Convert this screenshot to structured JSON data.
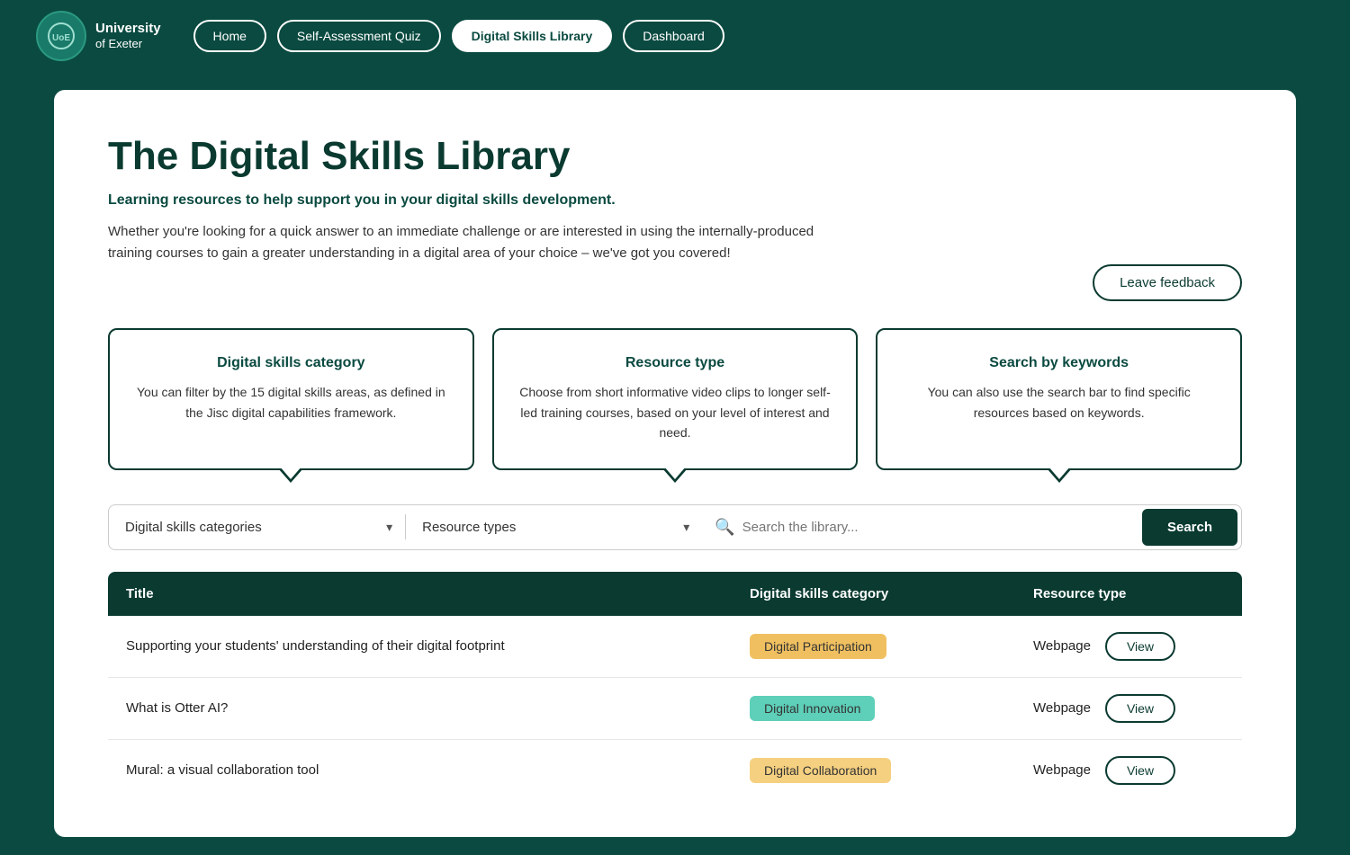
{
  "header": {
    "logo_text_line1": "University",
    "logo_text_line2": "of Exeter",
    "nav": {
      "items": [
        {
          "id": "home",
          "label": "Home",
          "active": false
        },
        {
          "id": "quiz",
          "label": "Self-Assessment Quiz",
          "active": false
        },
        {
          "id": "library",
          "label": "Digital Skills Library",
          "active": true
        },
        {
          "id": "dashboard",
          "label": "Dashboard",
          "active": false
        }
      ]
    }
  },
  "main": {
    "title": "The Digital Skills Library",
    "subtitle": "Learning resources to help support you in your digital skills development.",
    "description": "Whether you're looking for a quick answer to an immediate challenge or are interested in using the internally-produced training courses to gain a greater understanding in a digital area of your choice – we've got you covered!",
    "feedback_button": "Leave feedback",
    "info_cards": [
      {
        "id": "category-card",
        "title": "Digital skills category",
        "description": "You can filter by the 15 digital skills areas, as defined in the Jisc digital capabilities framework."
      },
      {
        "id": "resource-type-card",
        "title": "Resource type",
        "description": "Choose from short informative video clips to longer self-led training courses, based on your level of interest and need."
      },
      {
        "id": "search-card",
        "title": "Search by keywords",
        "description": "You can also use the search bar to find specific resources based on keywords."
      }
    ],
    "filters": {
      "category_placeholder": "Digital skills categories",
      "resource_placeholder": "Resource types",
      "search_placeholder": "Search the library...",
      "search_button": "Search"
    },
    "table": {
      "headers": [
        {
          "id": "title",
          "label": "Title"
        },
        {
          "id": "category",
          "label": "Digital skills category"
        },
        {
          "id": "resource",
          "label": "Resource type"
        }
      ],
      "rows": [
        {
          "id": "row-1",
          "title": "Supporting your students' understanding of their digital footprint",
          "category": "Digital Participation",
          "category_class": "badge-participation",
          "resource": "Webpage",
          "view_label": "View"
        },
        {
          "id": "row-2",
          "title": "What is Otter AI?",
          "category": "Digital Innovation",
          "category_class": "badge-innovation",
          "resource": "Webpage",
          "view_label": "View"
        },
        {
          "id": "row-3",
          "title": "Mural: a visual collaboration tool",
          "category": "Digital Collaboration",
          "category_class": "badge-collaboration",
          "resource": "Webpage",
          "view_label": "View"
        }
      ]
    }
  }
}
